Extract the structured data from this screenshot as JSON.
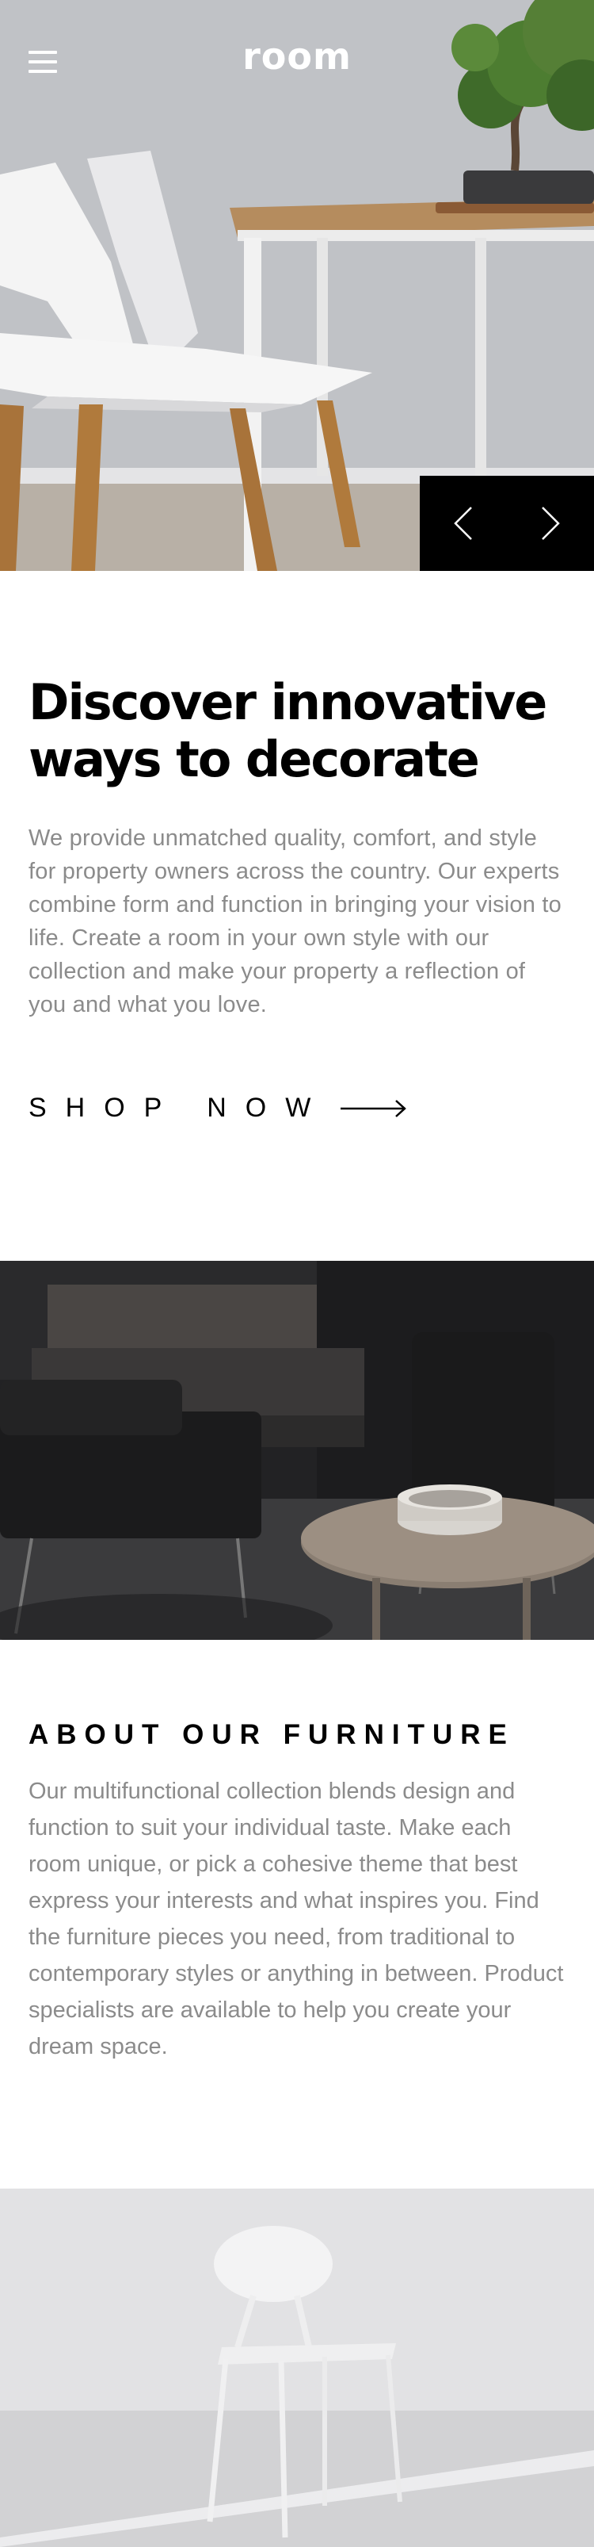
{
  "header": {
    "logo": "room",
    "menu_icon": "hamburger-icon"
  },
  "hero": {
    "prev_icon": "chevron-left-icon",
    "next_icon": "chevron-right-icon"
  },
  "intro": {
    "title": "Discover innovative ways to decorate",
    "body": "We provide unmatched quality, comfort, and style for property owners across the country. Our experts combine form and function in bringing your vision to life. Create a room in your own style with our collection and make your property a reflection of you and what you love.",
    "cta_label": "SHOP NOW",
    "cta_icon": "arrow-right-icon"
  },
  "about": {
    "title": "ABOUT OUR FURNITURE",
    "body": "Our multifunctional collection blends design and function to suit your individual taste. Make each room unique, or pick a cohesive theme that best express your interests and what inspires you. Find the furniture pieces you need, from traditional to contemporary styles or anything in between. Product specialists are available to help you create your dream space."
  },
  "colors": {
    "text_primary": "#000000",
    "text_body": "#8b8b8b",
    "control_bg": "#000000",
    "background": "#ffffff"
  }
}
